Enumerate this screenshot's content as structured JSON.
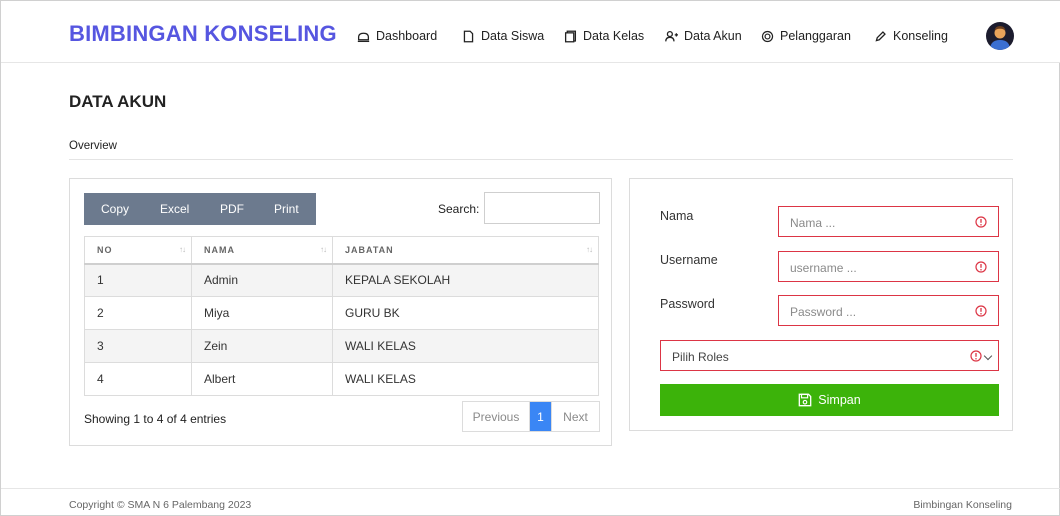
{
  "brand": "BIMBINGAN KONSELING",
  "nav": {
    "dashboard": "Dashboard",
    "data_siswa": "Data Siswa",
    "data_kelas": "Data Kelas",
    "data_akun": "Data Akun",
    "pelanggaran": "Pelanggaran",
    "konseling": "Konseling"
  },
  "page": {
    "title": "DATA AKUN",
    "section": "Overview"
  },
  "table_tools": {
    "buttons": [
      "Copy",
      "Excel",
      "PDF",
      "Print"
    ],
    "search_label": "Search:",
    "search_value": ""
  },
  "table": {
    "columns": [
      "NO",
      "NAMA",
      "JABATAN"
    ],
    "rows": [
      {
        "no": "1",
        "nama": "Admin",
        "jabatan": "KEPALA SEKOLAH"
      },
      {
        "no": "2",
        "nama": "Miya",
        "jabatan": "GURU BK"
      },
      {
        "no": "3",
        "nama": "Zein",
        "jabatan": "WALI KELAS"
      },
      {
        "no": "4",
        "nama": "Albert",
        "jabatan": "WALI KELAS"
      }
    ],
    "info": "Showing 1 to 4 of 4 entries",
    "pagination": {
      "previous": "Previous",
      "current": "1",
      "next": "Next"
    }
  },
  "form": {
    "nama_label": "Nama",
    "nama_placeholder": "Nama ...",
    "username_label": "Username",
    "username_placeholder": "username ...",
    "password_label": "Password",
    "password_placeholder": "Password ...",
    "roles_placeholder": "Pilih Roles",
    "save_label": "Simpan"
  },
  "footer": {
    "copyright": "Copyright © SMA N 6 Palembang 2023",
    "app_name": "Bimbingan Konseling"
  },
  "colors": {
    "brand": "#5656e0",
    "error": "#dc3545",
    "success": "#3cb30a",
    "pagination_active": "#3a86f5",
    "button_group": "#6c7a8e"
  }
}
